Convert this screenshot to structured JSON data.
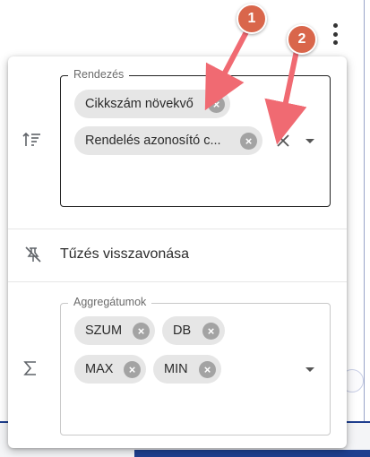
{
  "menu": {
    "kebab_icon": "more-vert-icon"
  },
  "sort_section": {
    "icon": "sort-ascending-icon",
    "legend": "Rendezés",
    "chips": [
      {
        "label": "Cikkszám növekvő"
      },
      {
        "label": "Rendelés azonosító c..."
      }
    ],
    "clear_icon": "clear-icon",
    "dropdown_icon": "caret-down-icon"
  },
  "unpin_section": {
    "icon": "unpin-icon",
    "label": "Tűzés visszavonása"
  },
  "aggregate_section": {
    "icon": "sigma-icon",
    "legend": "Aggregátumok",
    "chips": [
      {
        "label": "SZUM"
      },
      {
        "label": "DB"
      },
      {
        "label": "MAX"
      },
      {
        "label": "MIN"
      }
    ],
    "dropdown_icon": "caret-down-icon"
  },
  "annotations": {
    "badges": [
      {
        "label": "1",
        "color": "#d9664b"
      },
      {
        "label": "2",
        "color": "#d9664b"
      }
    ],
    "arrow_color": "#f06a72"
  }
}
